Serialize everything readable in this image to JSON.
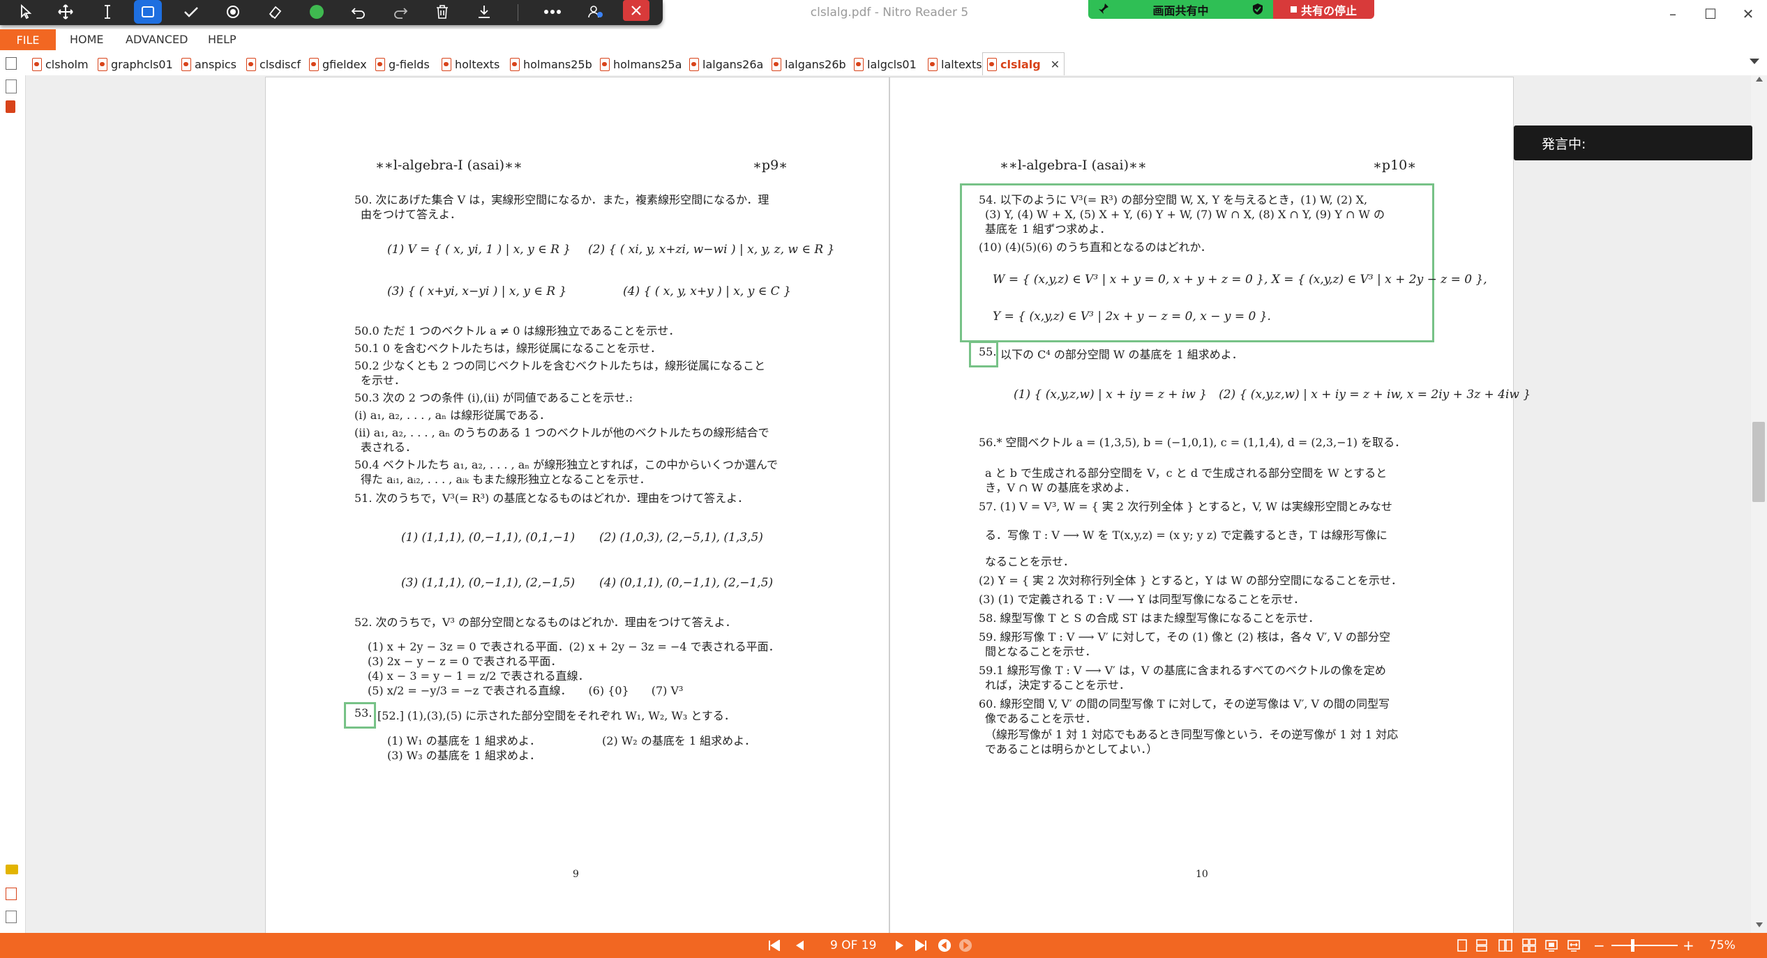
{
  "window": {
    "title": "clslalg.pdf - Nitro Reader 5",
    "minimize": "–",
    "maximize": "☐",
    "close": "✕"
  },
  "share": {
    "label": "画面共有中",
    "stop_label": "共有の停止"
  },
  "draw_toolbar": {
    "icons": [
      "cursor-icon",
      "move-icon",
      "text-cursor-icon",
      "rectangle-icon",
      "check-icon",
      "record-icon",
      "eraser-icon",
      "color-dot-icon",
      "undo-icon",
      "redo-icon",
      "trash-icon",
      "download-icon",
      "more-icon",
      "people-icon",
      "close-icon"
    ],
    "color_dot": "#3fb950"
  },
  "menu": {
    "file": "FILE",
    "items": [
      "HOME",
      "ADVANCED",
      "HELP"
    ]
  },
  "tabs": {
    "items": [
      "clsholm",
      "graphcls01",
      "anspics",
      "clsdiscf",
      "gfieldex",
      "g-fields",
      "holtexts",
      "holmans25b",
      "holmans25a",
      "lalgans26a",
      "lalgans26b",
      "lalgcls01",
      "laltexts"
    ],
    "active": "clslalg",
    "close": "✕"
  },
  "speaking": {
    "label": "発言中:"
  },
  "page9": {
    "header_left": "∗∗l-algebra-I (asai)∗∗",
    "header_right": "∗p9∗",
    "lines": [
      "50. 次にあげた集合 V は，実線形空間になるか．また，複素線形空間になるか．理",
      "由をつけて答えよ．",
      "(1) V = { ( x, yi, 1 ) | x, y ∈ R }",
      "(2) { ( xi, y, x+zi, w−wi ) | x, y, z, w ∈ R }",
      "(3) { ( x+yi, x−yi ) | x, y ∈ R }",
      "(4) { ( x, y, x+y ) | x, y ∈ C }",
      "50.0 ただ 1 つのベクトル a ≠ 0 は線形独立であることを示せ．",
      "50.1 0 を含むベクトルたちは，線形従属になることを示せ．",
      "50.2 少なくとも 2 つの同じベクトルを含むベクトルたちは，線形従属になること",
      "を示せ．",
      "50.3 次の 2 つの条件 (i),(ii) が同値であることを示せ.:",
      "(i) a₁, a₂, . . . , aₙ は線形従属である．",
      "(ii) a₁, a₂, . . . , aₙ のうちのある 1 つのベクトルが他のベクトルたちの線形結合で",
      "表される．",
      "50.4 ベクトルたち a₁, a₂, . . . , aₙ が線形独立とすれば，この中からいくつか選んで",
      "得た aᵢ₁, aᵢ₂, . . . , aᵢₖ もまた線形独立となることを示せ．",
      "51. 次のうちで，V³(= R³) の基底となるものはどれか．理由をつけて答えよ．",
      "(1) (1,1,1), (0,−1,1), (0,1,−1)",
      "(2) (1,0,3), (2,−5,1), (1,3,5)",
      "(3) (1,1,1), (0,−1,1), (2,−1,5)",
      "(4) (0,1,1), (0,−1,1), (2,−1,5)",
      "52. 次のうちで，V³ の部分空間となるものはどれか．理由をつけて答えよ．",
      "(1) x + 2y − 3z = 0 で表される平面．(2) x + 2y − 3z = −4 で表される平面．",
      "(3) 2x − y − z = 0 で表される平面．",
      "(4) x − 3 = y − 1 = z/2 で表される直線．",
      "(5) x/2 = −y/3 = −z で表される直線．　　(6) {0}　　(7) V³",
      "53.",
      "[52.] (1),(3),(5) に示された部分空間をそれぞれ W₁, W₂, W₃ とする．",
      "(1) W₁ の基底を 1 組求めよ．　　　　　　(2) W₂ の基底を 1 組求めよ．",
      "(3) W₃ の基底を 1 組求めよ．"
    ],
    "page_number": "9"
  },
  "page10": {
    "header_left": "∗∗l-algebra-I (asai)∗∗",
    "header_right": "∗p10∗",
    "lines": [
      "54. 以下のように V³(= R³) の部分空間 W, X, Y を与えるとき，(1) W, (2) X,",
      "(3) Y, (4) W + X, (5) X + Y, (6) Y + W, (7) W ∩ X, (8) X ∩ Y, (9) Y ∩ W の",
      "基底を 1 組ずつ求めよ．",
      "(10) (4)(5)(6) のうち直和となるのはどれか．",
      "W = { (x,y,z) ∈ V³ | x + y = 0, x + y + z = 0 },  X = { (x,y,z) ∈ V³ | x + 2y − z = 0 },",
      "Y = { (x,y,z) ∈ V³ | 2x + y − z = 0, x − y = 0 }.",
      "55.",
      "以下の C⁴ の部分空間 W の基底を 1 組求めよ．",
      "(1) { (x,y,z,w) | x + iy = z + iw }　(2) { (x,y,z,w) | x + iy = z + iw, x = 2iy + 3z + 4iw }",
      "56.* 空間ベクトル a = (1,3,5), b = (−1,0,1), c = (1,1,4), d = (2,3,−1) を取る．",
      "a と b で生成される部分空間を V，c と d で生成される部分空間を W とすると",
      "き，V ∩ W の基底を求めよ．",
      "57. (1) V = V³, W = { 実 2 次行列全体 } とすると，V, W は実線形空間とみなせ",
      "る．写像 T : V ⟶ W を T(x,y,z) = (x y; y z) で定義するとき，T は線形写像に",
      "なることを示せ．",
      "(2) Y = { 実 2 次対称行列全体 } とすると，Y は W の部分空間になることを示せ．",
      "(3) (1) で定義される T : V ⟶ Y は同型写像になることを示せ．",
      "58. 線型写像 T と S の合成 ST はまた線型写像になることを示せ．",
      "59. 線形写像 T : V ⟶ V′ に対して，その (1) 像と (2) 核は，各々 V′, V の部分空",
      "間となることを示せ．",
      "59.1 線形写像 T : V ⟶ V′ は，V の基底に含まれるすべてのベクトルの像を定め",
      "れば，決定することを示せ．",
      "60. 線形空間 V, V′ の間の同型写像 T に対して，その逆写像は V′, V の間の同型写",
      "像であることを示せ．",
      "（線形写像が 1 対 1 対応でもあるとき同型写像という．その逆写像が 1 対 1 対応",
      "であることは明らかとしてよい．）"
    ],
    "page_number": "10"
  },
  "statusbar": {
    "page_indicator": "9 OF 19",
    "zoom": "75%",
    "zoom_minus": "−",
    "zoom_plus": "+",
    "color": "#f26722"
  }
}
